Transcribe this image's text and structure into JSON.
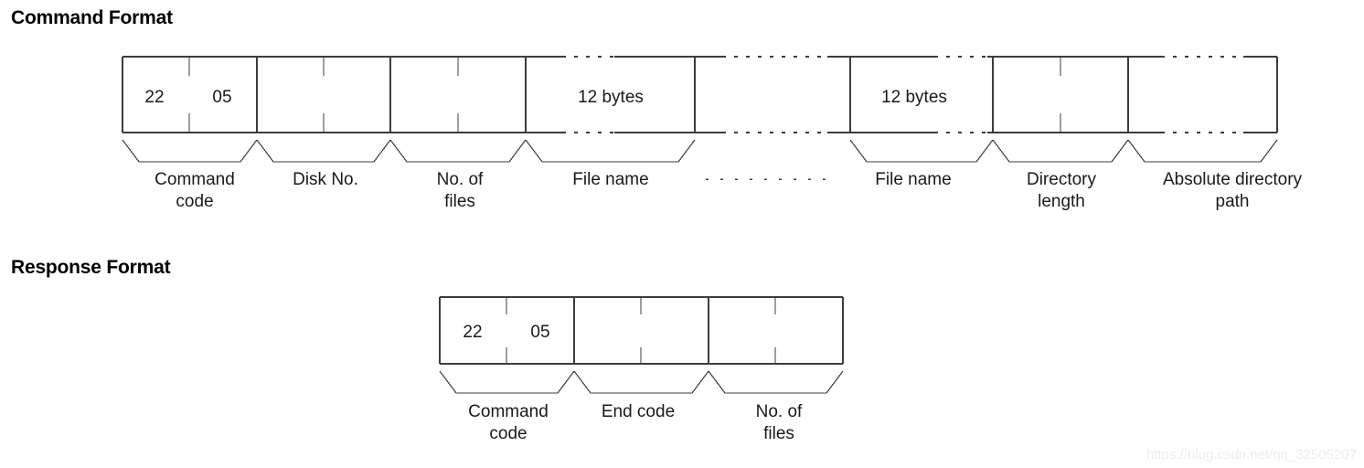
{
  "command": {
    "title": "Command Format",
    "cells": [
      {
        "value": "22",
        "label": "Command code"
      },
      {
        "value": "05",
        "label": ""
      },
      {
        "value": "",
        "label": "Disk No."
      },
      {
        "value": "",
        "label": "No. of files"
      },
      {
        "value": "12 bytes",
        "label": "File name"
      },
      {
        "value": "",
        "label": "File name"
      },
      {
        "value": "12 bytes",
        "label": ""
      },
      {
        "value": "",
        "label": "Directory length"
      },
      {
        "value": "",
        "label": "Absolute directory path"
      }
    ],
    "labels": {
      "command_code": "Command\ncode",
      "command_code_line1": "Command",
      "command_code_line2": "code",
      "disk_no": "Disk No.",
      "no_of_files_line1": "No. of",
      "no_of_files_line2": "files",
      "file_name_1": "File name",
      "file_name_2": "File name",
      "directory_length_line1": "Directory",
      "directory_length_line2": "length",
      "absolute_path_line1": "Absolute directory",
      "absolute_path_line2": "path"
    },
    "byte_notes": {
      "file_name_1": "12 bytes",
      "file_name_2": "12 bytes"
    },
    "values": {
      "command_code_hi": "22",
      "command_code_lo": "05"
    },
    "repeat_indicator": "dotted-ellipsis"
  },
  "response": {
    "title": "Response Format",
    "values": {
      "command_code_hi": "22",
      "command_code_lo": "05"
    },
    "labels": {
      "command_code_line1": "Command",
      "command_code_line2": "code",
      "end_code": "End code",
      "no_of_files_line1": "No. of",
      "no_of_files_line2": "files"
    }
  },
  "watermark": "https://blog.csdn.net/qq_32505207",
  "colors": {
    "line": "#3c3c3c",
    "text": "#1a1a1a",
    "title": "#000000",
    "watermark": "#ededed",
    "background": "#ffffff"
  }
}
